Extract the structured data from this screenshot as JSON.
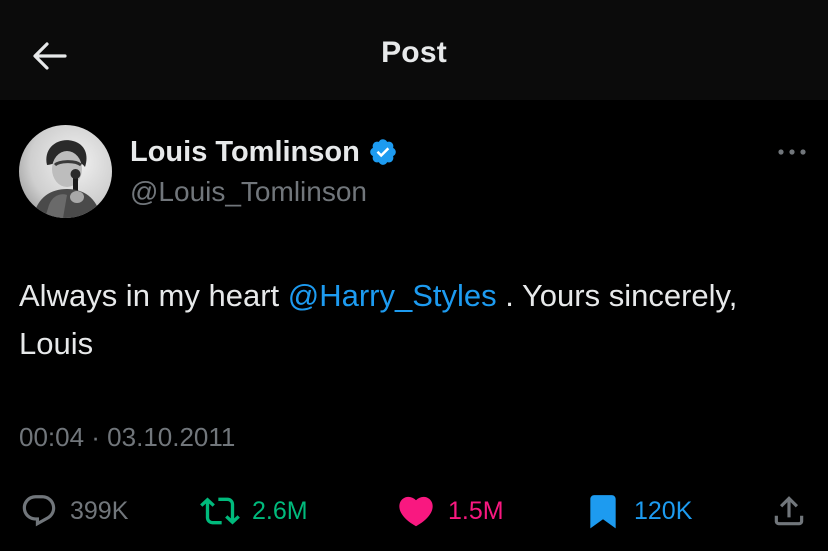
{
  "header": {
    "title": "Post",
    "back_icon": "arrow-left-icon"
  },
  "author": {
    "display_name": "Louis Tomlinson",
    "handle": "@Louis_Tomlinson",
    "verified": true,
    "verified_icon": "verified-badge-icon",
    "avatar": "avatar-photo"
  },
  "tweet": {
    "text_before": "Always in my heart ",
    "mention": "@Harry_Styles",
    "text_after": " . Yours sincerely, Louis",
    "timestamp": "00:04 · 03.10.2011"
  },
  "actions": {
    "reply_count": "399K",
    "retweet_count": "2.6M",
    "like_count": "1.5M",
    "bookmark_count": "120K",
    "share_icon": "share-icon"
  },
  "colors": {
    "background": "#000000",
    "header_background": "#0b0b0b",
    "text_primary": "#e7e9ea",
    "text_secondary": "#71767b",
    "accent_blue": "#1d9bf0",
    "retweet_green": "#00ba7c",
    "like_pink": "#f91880"
  }
}
